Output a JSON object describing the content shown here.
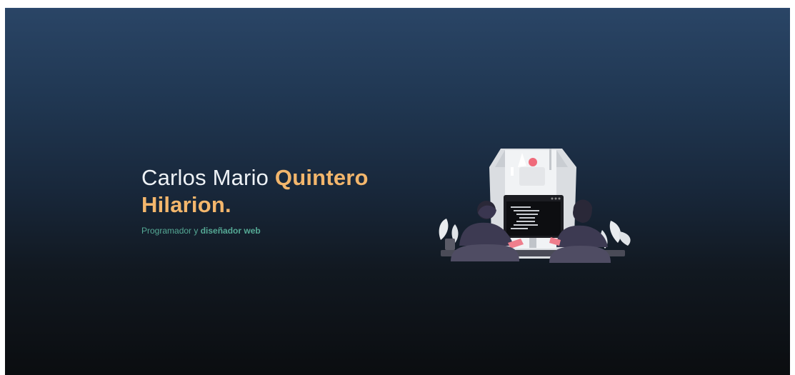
{
  "hero": {
    "name_part1": "Carlos Mario ",
    "name_part2": "Quintero",
    "name_part3": "Hilarion.",
    "tagline_part1": "Programador y ",
    "tagline_part2": "diseñador web"
  },
  "illustration": {
    "icon": "developers-at-computer-icon"
  },
  "colors": {
    "accent": "#f3b66c",
    "secondary": "#55a995",
    "text": "#eef2f6",
    "bg_top": "#2a4566",
    "bg_bottom": "#0b0d10"
  }
}
